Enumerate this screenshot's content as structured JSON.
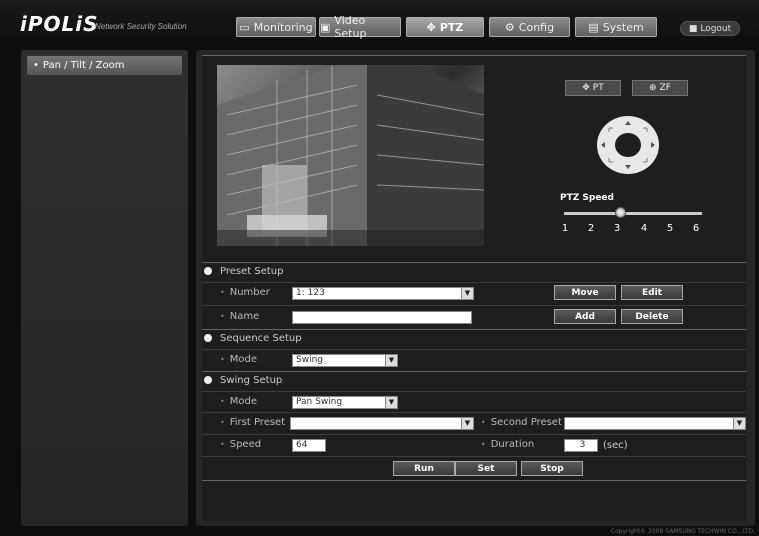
{
  "header": {
    "logo": "iPOLiS",
    "logo_sub": "Network Security Solution",
    "nav": [
      {
        "label": "Monitoring",
        "icon": "monitor-icon"
      },
      {
        "label": "Video Setup",
        "icon": "camera-icon"
      },
      {
        "label": "PTZ",
        "icon": "ptz-arrows-icon"
      },
      {
        "label": "Config",
        "icon": "gear-icon"
      },
      {
        "label": "System",
        "icon": "system-icon"
      }
    ],
    "logout": "Logout"
  },
  "sidebar": {
    "items": [
      {
        "label": "Pan / Tilt / Zoom"
      }
    ]
  },
  "ptz": {
    "pt_label": "PT",
    "zf_label": "ZF",
    "speed_label": "PTZ Speed",
    "speed_ticks": [
      "1",
      "2",
      "3",
      "4",
      "5",
      "6"
    ],
    "speed_value": 3
  },
  "preset": {
    "title": "Preset Setup",
    "number_label": "Number",
    "number_value": "1: 123",
    "name_label": "Name",
    "name_value": "",
    "move": "Move",
    "edit": "Edit",
    "add": "Add",
    "delete": "Delete"
  },
  "sequence": {
    "title": "Sequence Setup",
    "mode_label": "Mode",
    "mode_value": "Swing"
  },
  "swing": {
    "title": "Swing Setup",
    "mode_label": "Mode",
    "mode_value": "Pan Swing",
    "first_label": "First Preset",
    "first_value": "",
    "second_label": "Second Preset",
    "second_value": "",
    "speed_label": "Speed",
    "speed_value": "64",
    "duration_label": "Duration",
    "duration_value": "3",
    "duration_unit": "(sec)",
    "run": "Run",
    "set": "Set",
    "stop": "Stop"
  },
  "footer": {
    "copyright": "Copyright© 2008 SAMSUNG TECHWIN CO., LTD."
  },
  "colors": {
    "background": "#0e0e0e",
    "panel": "#1e1e1e",
    "button": "#5a5a5a"
  }
}
